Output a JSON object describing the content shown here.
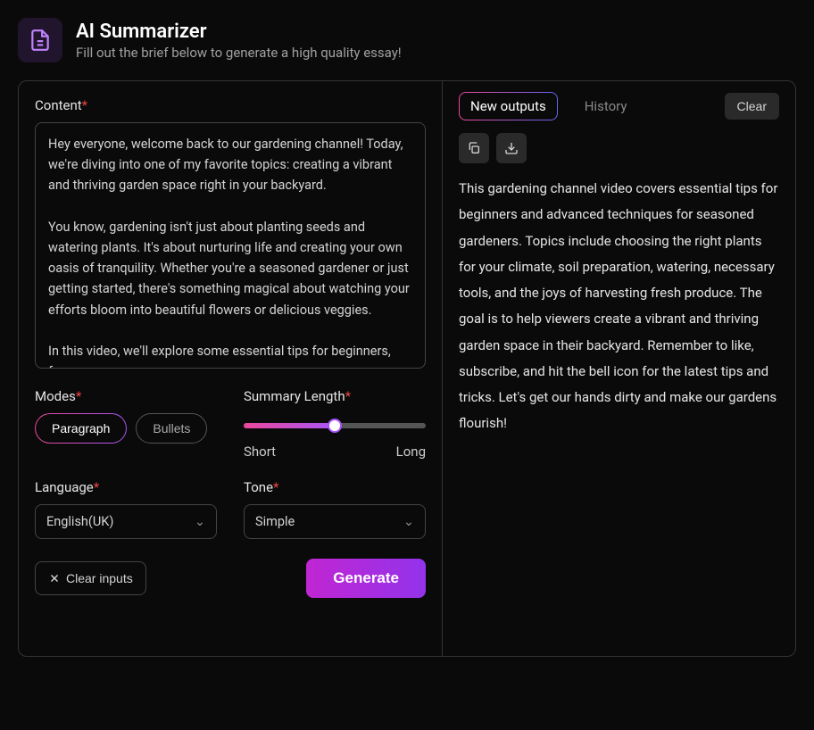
{
  "header": {
    "title": "AI Summarizer",
    "subtitle": "Fill out the brief below to generate a high quality essay!"
  },
  "left": {
    "content_label": "Content",
    "content_value": "Hey everyone, welcome back to our gardening channel! Today, we're diving into one of my favorite topics: creating a vibrant and thriving garden space right in your backyard.\n\nYou know, gardening isn't just about planting seeds and watering plants. It's about nurturing life and creating your own oasis of tranquility. Whether you're a seasoned gardener or just getting started, there's something magical about watching your efforts bloom into beautiful flowers or delicious veggies.\n\nIn this video, we'll explore some essential tips for beginners, from",
    "modes_label": "Modes",
    "modes": {
      "paragraph": "Paragraph",
      "bullets": "Bullets"
    },
    "length_label": "Summary Length",
    "length_short": "Short",
    "length_long": "Long",
    "language_label": "Language",
    "language_value": "English(UK)",
    "tone_label": "Tone",
    "tone_value": "Simple",
    "clear_inputs": "Clear inputs",
    "generate": "Generate"
  },
  "right": {
    "tab_new": "New outputs",
    "tab_history": "History",
    "clear": "Clear",
    "output": "This gardening channel video covers essential tips for beginners and advanced techniques for seasoned gardeners. Topics include choosing the right plants for your climate, soil preparation, watering, necessary tools, and the joys of harvesting fresh produce. The goal is to help viewers create a vibrant and thriving garden space in their backyard. Remember to like, subscribe, and hit the bell icon for the latest tips and tricks. Let's get our hands dirty and make our gardens flourish!"
  }
}
